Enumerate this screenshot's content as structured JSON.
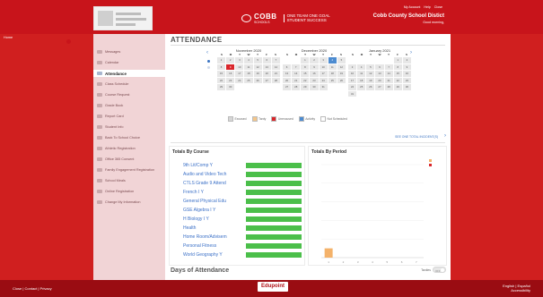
{
  "header": {
    "top_links": [
      "My Account",
      "Help",
      "Close"
    ],
    "cobb_word": "COBB",
    "cobb_sub": "SCHOOLS",
    "cobb_tagline_1": "ONE TEAM ONE GOAL",
    "cobb_tagline_2": "STUDENT SUCCESS",
    "district": "Cobb County School Distict",
    "greeting": "Good morning,",
    "colors": {
      "brand": "#c8141b",
      "sidebar": "#f1d4d6"
    }
  },
  "sidebar": {
    "home_label": "Home",
    "items": [
      {
        "label": "Messages",
        "icon": "mail-icon"
      },
      {
        "label": "Calendar",
        "icon": "calendar-icon"
      },
      {
        "label": "Attendance",
        "icon": "attendance-icon",
        "active": true
      },
      {
        "label": "Class Schedule",
        "icon": "schedule-icon"
      },
      {
        "label": "Course Request",
        "icon": "request-icon"
      },
      {
        "label": "Grade Book",
        "icon": "gradebook-icon"
      },
      {
        "label": "Report Card",
        "icon": "report-card-icon"
      },
      {
        "label": "Student Info",
        "icon": "student-icon"
      },
      {
        "label": "Back To School Choice",
        "icon": "school-icon"
      },
      {
        "label": "Athletic Registration",
        "icon": "athletic-icon"
      },
      {
        "label": "Office 365 Consent",
        "icon": "consent-icon"
      },
      {
        "label": "Family Engagement Registration",
        "icon": "family-icon"
      },
      {
        "label": "School Meals",
        "icon": "meals-icon"
      },
      {
        "label": "Online Registration",
        "icon": "registration-icon"
      },
      {
        "label": "Change My Information",
        "icon": "edit-icon"
      }
    ]
  },
  "page_title": "ATTENDANCE",
  "calendars": [
    {
      "title": "November 2020",
      "dow": [
        "S",
        "M",
        "T",
        "W",
        "T",
        "F",
        "S"
      ],
      "start_offset": 0,
      "days": 30,
      "unexcused": [
        9
      ],
      "activity": []
    },
    {
      "title": "December 2020",
      "dow": [
        "S",
        "M",
        "T",
        "W",
        "T",
        "F",
        "S"
      ],
      "start_offset": 2,
      "days": 31,
      "unexcused": [],
      "activity": [
        4
      ]
    },
    {
      "title": "January 2021",
      "dow": [
        "S",
        "M",
        "T",
        "W",
        "T",
        "F",
        "S"
      ],
      "start_offset": 5,
      "days": 31,
      "unexcused": [],
      "activity": []
    }
  ],
  "legend": [
    {
      "label": "Excused",
      "color": "#d6d6d6"
    },
    {
      "label": "Tardy",
      "color": "#f4c68a"
    },
    {
      "label": "Unexcused",
      "color": "#d9262b"
    },
    {
      "label": "Activity",
      "color": "#4c8bd0"
    },
    {
      "label": "Not Scheduled",
      "color": "#ffffff"
    }
  ],
  "more_link": "SEE ONE TOTAL INCIDENT(S)",
  "totals_by_course": {
    "title": "Totals By Course",
    "courses": [
      {
        "name": "9th Lit/Comp Y",
        "bar": 1.0
      },
      {
        "name": "Audio and Video Tech",
        "bar": 1.0
      },
      {
        "name": "CTLS Grade 9 Attend",
        "bar": 1.0
      },
      {
        "name": "French I Y",
        "bar": 1.0
      },
      {
        "name": "General Physical Edu",
        "bar": 1.0
      },
      {
        "name": "GSE Algebra I Y",
        "bar": 1.0
      },
      {
        "name": "H Biology I Y",
        "bar": 1.0
      },
      {
        "name": "Health",
        "bar": 1.0
      },
      {
        "name": "Home Room/Advisem",
        "bar": 1.0
      },
      {
        "name": "Personal Fitness",
        "bar": 1.0
      },
      {
        "name": "World Geography Y",
        "bar": 1.0
      }
    ]
  },
  "totals_by_period": {
    "title": "Totals By Period"
  },
  "chart_data": {
    "type": "bar",
    "categories": [
      "1",
      "2",
      "3",
      "4",
      "5",
      "6",
      "7"
    ],
    "series": [
      {
        "name": "",
        "values": [
          1,
          0,
          0,
          0,
          0,
          0,
          0
        ],
        "color": "#f4b26a"
      },
      {
        "name": "",
        "values": [
          0,
          0,
          0,
          0,
          0,
          0,
          0
        ],
        "color": "#d9262b"
      }
    ],
    "xlabel": "",
    "ylabel": "",
    "ylim": [
      0,
      10
    ],
    "grid": true,
    "legend": "top-right"
  },
  "days_title": "Days of Attendance",
  "toggle": {
    "label": "Tardies",
    "state": "OFF"
  },
  "footer": {
    "links": "Close | Contact | Privacy",
    "brand": "Edupoint",
    "lang_1": "English | Español",
    "lang_2": "Accessibility"
  }
}
